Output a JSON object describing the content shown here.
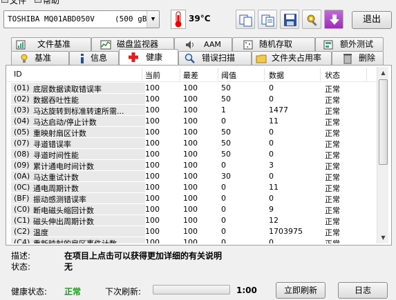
{
  "menu": {
    "file": "文件",
    "help": "帮助"
  },
  "drive": {
    "name": "TOSHIBA MQ01ABD050V",
    "size": "(500 gB)"
  },
  "temperature": "39°C",
  "toolbar": {
    "icons": [
      "copy-icon",
      "copy-text-icon",
      "save-icon",
      "tools-icon",
      "download-icon"
    ],
    "exit_label": "退出"
  },
  "tabs_row1": [
    {
      "label": "文件基准",
      "icon": "file-benchmark-icon"
    },
    {
      "label": "磁盘监视器",
      "icon": "disk-monitor-icon"
    },
    {
      "label": "AAM",
      "icon": "speaker-icon"
    },
    {
      "label": "随机存取",
      "icon": "random-access-icon"
    },
    {
      "label": "额外测试",
      "icon": "extra-tests-icon"
    }
  ],
  "tabs_row2": [
    {
      "label": "基准",
      "icon": "benchmark-icon"
    },
    {
      "label": "信息",
      "icon": "info-icon"
    },
    {
      "label": "健康",
      "icon": "health-cross-icon",
      "active": true
    },
    {
      "label": "错误扫描",
      "icon": "error-scan-icon"
    },
    {
      "label": "文件夹占用率",
      "icon": "folder-icon"
    },
    {
      "label": "删除",
      "icon": "erase-icon"
    }
  ],
  "table": {
    "headers": {
      "id": "ID",
      "current": "当前",
      "worst": "最差",
      "threshold": "阈值",
      "data": "数据",
      "status": "状态"
    },
    "rows": [
      {
        "id": "(01)",
        "name": "底层数据读取错误率",
        "current": "100",
        "worst": "100",
        "threshold": "50",
        "data": "0",
        "status": "正常"
      },
      {
        "id": "(02)",
        "name": "数据吞吐性能",
        "current": "100",
        "worst": "100",
        "threshold": "50",
        "data": "0",
        "status": "正常"
      },
      {
        "id": "(03)",
        "name": "马达旋转到标准转速所需...",
        "current": "100",
        "worst": "100",
        "threshold": "1",
        "data": "1477",
        "status": "正常"
      },
      {
        "id": "(04)",
        "name": "马达启动/停止计数",
        "current": "100",
        "worst": "100",
        "threshold": "0",
        "data": "11",
        "status": "正常"
      },
      {
        "id": "(05)",
        "name": "重映射扇区计数",
        "current": "100",
        "worst": "100",
        "threshold": "50",
        "data": "0",
        "status": "正常"
      },
      {
        "id": "(07)",
        "name": "寻道错误率",
        "current": "100",
        "worst": "100",
        "threshold": "50",
        "data": "0",
        "status": "正常"
      },
      {
        "id": "(08)",
        "name": "寻道时间性能",
        "current": "100",
        "worst": "100",
        "threshold": "50",
        "data": "0",
        "status": "正常"
      },
      {
        "id": "(09)",
        "name": "累计通电时间计数",
        "current": "100",
        "worst": "100",
        "threshold": "0",
        "data": "3",
        "status": "正常"
      },
      {
        "id": "(0A)",
        "name": "马达重试计数",
        "current": "100",
        "worst": "100",
        "threshold": "30",
        "data": "0",
        "status": "正常"
      },
      {
        "id": "(0C)",
        "name": "通电周期计数",
        "current": "100",
        "worst": "100",
        "threshold": "0",
        "data": "11",
        "status": "正常"
      },
      {
        "id": "(BF)",
        "name": "振动感测错误率",
        "current": "100",
        "worst": "100",
        "threshold": "0",
        "data": "0",
        "status": "正常"
      },
      {
        "id": "(C0)",
        "name": "断电磁头缩回计数",
        "current": "100",
        "worst": "100",
        "threshold": "0",
        "data": "9",
        "status": "正常"
      },
      {
        "id": "(C1)",
        "name": "磁头伸出周期计数",
        "current": "100",
        "worst": "100",
        "threshold": "0",
        "data": "12",
        "status": "正常"
      },
      {
        "id": "(C2)",
        "name": "温度",
        "current": "100",
        "worst": "100",
        "threshold": "0",
        "data": "1703975",
        "status": "正常"
      },
      {
        "id": "(C4)",
        "name": "重新映射的扇区事件计数",
        "current": "100",
        "worst": "100",
        "threshold": "0",
        "data": "0",
        "status": "正常"
      }
    ]
  },
  "description": {
    "label": "描述:",
    "value": "在项目上点击可以获得更加详细的有关说明"
  },
  "status": {
    "label": "状态:",
    "value": "无"
  },
  "footer": {
    "health_label": "健康状态:",
    "health_value": "正常",
    "health_color": "#1a9a1a",
    "refresh_label": "下次刷新:",
    "refresh_progress": 0,
    "countdown": "1:00",
    "refresh_button": "立即刷新",
    "log_button": "日志"
  }
}
